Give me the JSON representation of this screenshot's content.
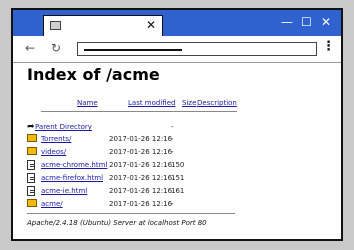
{
  "browser": {
    "tab_close": "✕",
    "minimize": "—",
    "maximize": "☐",
    "close": "✕",
    "back": "←",
    "reload": "↻",
    "menu": "⋮"
  },
  "page": {
    "title": "Index of /acme",
    "columns": {
      "name": "Name",
      "last_modified": "Last modified",
      "size": "Size",
      "description": "Description"
    },
    "entries": [
      {
        "icon": "back-arrow-icon",
        "name": "Parent Directory",
        "date": "",
        "size": "-"
      },
      {
        "icon": "folder-icon",
        "name": "Torrents/",
        "date": "2017-01-26 12:16",
        "size": "-"
      },
      {
        "icon": "folder-icon",
        "name": "videos/",
        "date": "2017-01-26 12:16",
        "size": "-"
      },
      {
        "icon": "file-icon",
        "name": "acme-chrome.html",
        "date": "2017-01-26 12:16",
        "size": "150"
      },
      {
        "icon": "file-icon",
        "name": "acme-firefox.html",
        "date": "2017-01-26 12:16",
        "size": "151"
      },
      {
        "icon": "file-icon",
        "name": "acme-ie.html",
        "date": "2017-01-26 12:16",
        "size": "161"
      },
      {
        "icon": "folder-icon",
        "name": "acme/",
        "date": "2017-01-26 12:16",
        "size": "-"
      }
    ],
    "footer": "Apache/2.4.18 (Ubuntu) Server at localhost Port 80"
  }
}
